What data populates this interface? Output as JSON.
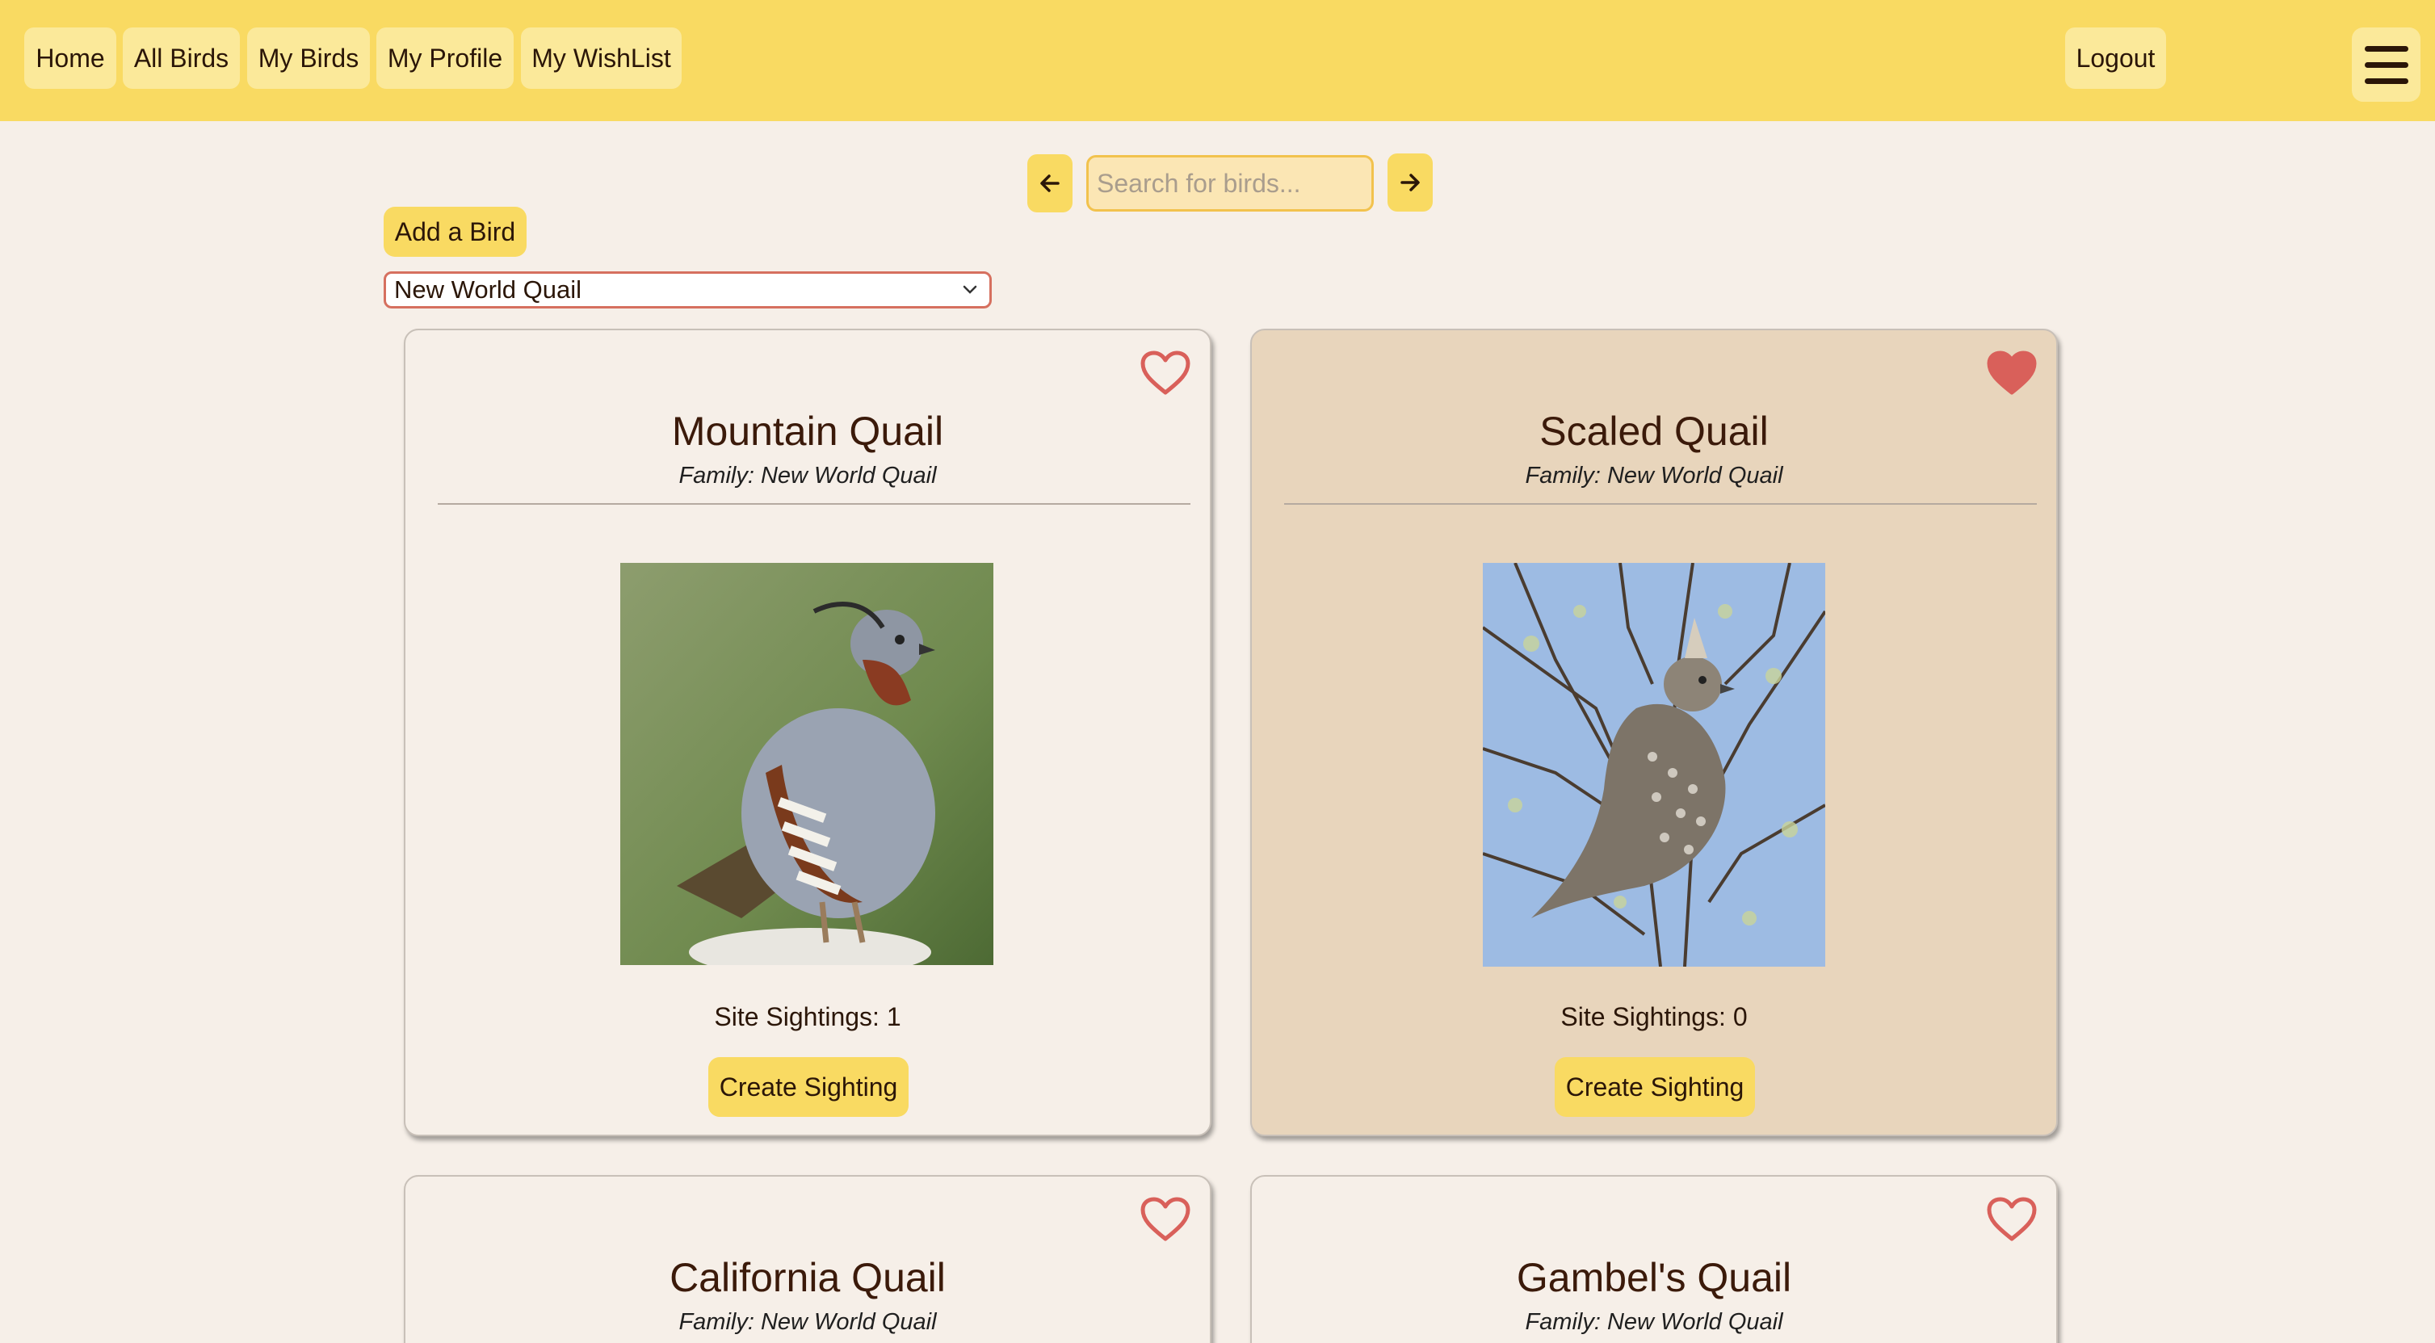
{
  "nav": {
    "home": "Home",
    "all_birds": "All Birds",
    "my_birds": "My Birds",
    "my_profile": "My Profile",
    "my_wishlist": "My WishList",
    "logout": "Logout",
    "menu_icon": "hamburger-menu-icon"
  },
  "search": {
    "placeholder": "Search for birds...",
    "value": "",
    "prev_icon": "arrow-left-icon",
    "next_icon": "arrow-right-icon"
  },
  "controls": {
    "add_bird": "Add a Bird",
    "family_filter": "New World Quail"
  },
  "colors": {
    "header": "#f9da62",
    "button": "#fbe99a",
    "background": "#f6efe8",
    "favorite_card": "#e8d5bc",
    "heart": "#d9605a"
  },
  "cards": [
    {
      "name": "Mountain Quail",
      "family": "Family: New World Quail",
      "sightings": "Site Sightings: 1",
      "button": "Create Sighting",
      "favorited": false
    },
    {
      "name": "Scaled Quail",
      "family": "Family: New World Quail",
      "sightings": "Site Sightings: 0",
      "button": "Create Sighting",
      "favorited": true
    },
    {
      "name": "California Quail",
      "family": "Family: New World Quail",
      "favorited": false
    },
    {
      "name": "Gambel's Quail",
      "family": "Family: New World Quail",
      "favorited": false
    }
  ]
}
